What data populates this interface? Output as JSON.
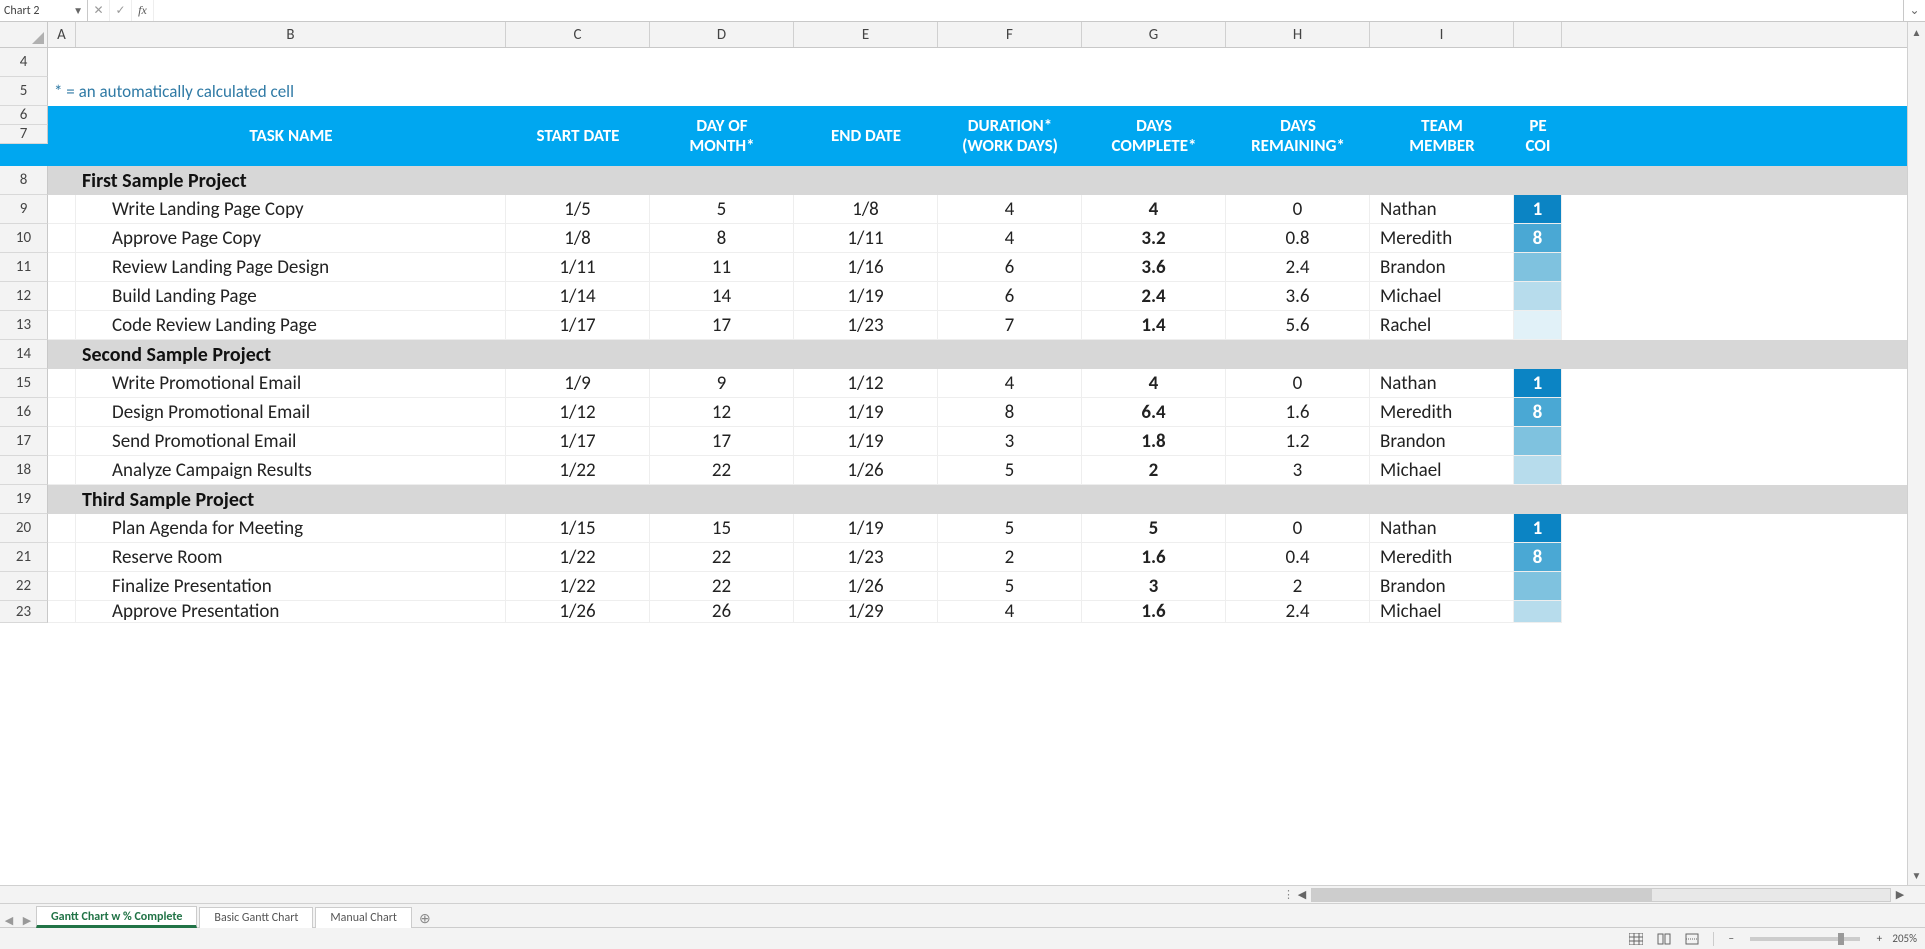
{
  "name_box": "Chart 2",
  "note": "* = an automatically calculated cell",
  "col_letters": [
    "A",
    "B",
    "C",
    "D",
    "E",
    "F",
    "G",
    "H",
    "I"
  ],
  "row_numbers_visible": [
    "4",
    "5",
    "6",
    "7",
    "8",
    "9",
    "10",
    "11",
    "12",
    "13",
    "14",
    "15",
    "16",
    "17",
    "18",
    "19",
    "20",
    "21",
    "22",
    "23"
  ],
  "headers": {
    "task": "TASK NAME",
    "start": "START DATE",
    "dayof": "DAY OF MONTH*",
    "end": "END DATE",
    "dur": "DURATION* (WORK DAYS)",
    "dcomp": "DAYS COMPLETE*",
    "drem": "DAYS REMAINING*",
    "team": "TEAM MEMBER",
    "pcomp": "PERCENT COMPLETE"
  },
  "projects": [
    {
      "title": "First Sample Project",
      "rows": [
        {
          "task": "Write Landing Page Copy",
          "start": "1/5",
          "dayof": "5",
          "end": "1/8",
          "dur": "4",
          "dcomp": "4",
          "drem": "0",
          "team": "Nathan",
          "jbg": "#0b84c4",
          "jval": "1"
        },
        {
          "task": "Approve Page Copy",
          "start": "1/8",
          "dayof": "8",
          "end": "1/11",
          "dur": "4",
          "dcomp": "3.2",
          "drem": "0.8",
          "team": "Meredith",
          "jbg": "#4aa8d4",
          "jval": "8"
        },
        {
          "task": "Review Landing Page Design",
          "start": "1/11",
          "dayof": "11",
          "end": "1/16",
          "dur": "6",
          "dcomp": "3.6",
          "drem": "2.4",
          "team": "Brandon",
          "jbg": "#7fc2df",
          "jval": ""
        },
        {
          "task": "Build Landing Page",
          "start": "1/14",
          "dayof": "14",
          "end": "1/19",
          "dur": "6",
          "dcomp": "2.4",
          "drem": "3.6",
          "team": "Michael",
          "jbg": "#b7dcec",
          "jval": ""
        },
        {
          "task": "Code Review Landing Page",
          "start": "1/17",
          "dayof": "17",
          "end": "1/23",
          "dur": "7",
          "dcomp": "1.4",
          "drem": "5.6",
          "team": "Rachel",
          "jbg": "#e1f1f8",
          "jval": ""
        }
      ]
    },
    {
      "title": "Second Sample Project",
      "rows": [
        {
          "task": "Write Promotional Email",
          "start": "1/9",
          "dayof": "9",
          "end": "1/12",
          "dur": "4",
          "dcomp": "4",
          "drem": "0",
          "team": "Nathan",
          "jbg": "#0b84c4",
          "jval": "1"
        },
        {
          "task": "Design Promotional Email",
          "start": "1/12",
          "dayof": "12",
          "end": "1/19",
          "dur": "8",
          "dcomp": "6.4",
          "drem": "1.6",
          "team": "Meredith",
          "jbg": "#4aa8d4",
          "jval": "8"
        },
        {
          "task": "Send Promotional Email",
          "start": "1/17",
          "dayof": "17",
          "end": "1/19",
          "dur": "3",
          "dcomp": "1.8",
          "drem": "1.2",
          "team": "Brandon",
          "jbg": "#7fc2df",
          "jval": ""
        },
        {
          "task": "Analyze Campaign Results",
          "start": "1/22",
          "dayof": "22",
          "end": "1/26",
          "dur": "5",
          "dcomp": "2",
          "drem": "3",
          "team": "Michael",
          "jbg": "#b7dcec",
          "jval": ""
        }
      ]
    },
    {
      "title": "Third Sample Project",
      "rows": [
        {
          "task": "Plan Agenda for Meeting",
          "start": "1/15",
          "dayof": "15",
          "end": "1/19",
          "dur": "5",
          "dcomp": "5",
          "drem": "0",
          "team": "Nathan",
          "jbg": "#0b84c4",
          "jval": "1"
        },
        {
          "task": "Reserve Room",
          "start": "1/22",
          "dayof": "22",
          "end": "1/23",
          "dur": "2",
          "dcomp": "1.6",
          "drem": "0.4",
          "team": "Meredith",
          "jbg": "#4aa8d4",
          "jval": "8"
        },
        {
          "task": "Finalize Presentation",
          "start": "1/22",
          "dayof": "22",
          "end": "1/26",
          "dur": "5",
          "dcomp": "3",
          "drem": "2",
          "team": "Brandon",
          "jbg": "#7fc2df",
          "jval": ""
        },
        {
          "task": "Approve Presentation",
          "start": "1/26",
          "dayof": "26",
          "end": "1/29",
          "dur": "4",
          "dcomp": "1.6",
          "drem": "2.4",
          "team": "Michael",
          "jbg": "#b7dcec",
          "jval": ""
        }
      ]
    }
  ],
  "tabs": {
    "t1": "Gantt Chart w % Complete",
    "t2": "Basic Gantt Chart",
    "t3": "Manual Chart"
  },
  "zoom": "205%",
  "headers_j_trim": "PE",
  "headers_j_trim2": "COI"
}
